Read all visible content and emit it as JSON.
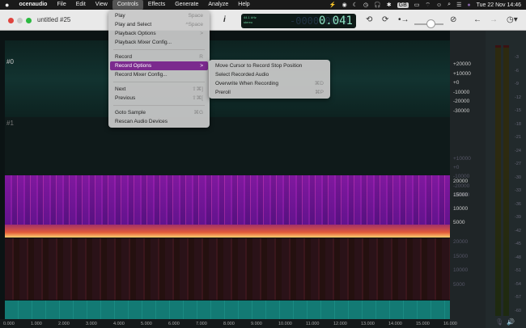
{
  "menubar": {
    "app": "ocenaudio",
    "items": [
      "File",
      "Edit",
      "View",
      "Controls",
      "Effects",
      "Generate",
      "Analyze",
      "Help"
    ],
    "clock": "Tue 22 Nov  14:46",
    "keyboard": "GB"
  },
  "window": {
    "title": "untitled #25",
    "info": "i"
  },
  "lcd": {
    "rate": "44.1 kHz",
    "channels": "stereo",
    "ghost": "-0000:00:0",
    "time": "0.041"
  },
  "tracks": [
    {
      "label": "#0"
    },
    {
      "label": "#1"
    }
  ],
  "controls_menu": [
    {
      "label": "Play",
      "shortcut": "Space"
    },
    {
      "label": "Play and Select",
      "shortcut": "^Space"
    },
    {
      "label": "Playback Options",
      "shortcut": ">"
    },
    {
      "label": "Playback Mixer Config...",
      "shortcut": ""
    },
    {
      "label": "Record",
      "shortcut": "R"
    },
    {
      "label": "Record Options",
      "shortcut": ">"
    },
    {
      "label": "Record Mixer Config...",
      "shortcut": ""
    },
    {
      "label": "Next",
      "shortcut": "⇧⌘]"
    },
    {
      "label": "Previous",
      "shortcut": "⇧⌘["
    },
    {
      "label": "Goto Sample",
      "shortcut": "⌘G"
    },
    {
      "label": "Rescan Audio Devices",
      "shortcut": ""
    }
  ],
  "record_options_menu": [
    {
      "label": "Move Cursor to Record Stop Position",
      "shortcut": ""
    },
    {
      "label": "Select Recorded Audio",
      "shortcut": ""
    },
    {
      "label": "Overwrite When Recording",
      "shortcut": "⌘D"
    },
    {
      "label": "Preroll",
      "shortcut": "⌘P"
    }
  ],
  "wave_scale": [
    "+20000",
    "+10000",
    "+0",
    "-10000",
    "-20000",
    "-30000"
  ],
  "wave_scale_dim": [
    "+10000",
    "+0",
    "-10000",
    "-20000",
    "-30000"
  ],
  "spec_scale": [
    "20000",
    "15000",
    "10000",
    "5000"
  ],
  "spec_scale_dim": [
    "20000",
    "15000",
    "10000",
    "5000"
  ],
  "meter_db": [
    "-3",
    "-6",
    "-9",
    "-12",
    "-15",
    "-18",
    "-21",
    "-24",
    "-27",
    "-30",
    "-33",
    "-36",
    "-39",
    "-42",
    "-45",
    "-48",
    "-51",
    "-54",
    "-57",
    "-60"
  ],
  "ruler": [
    "0.000",
    "1.000",
    "2.000",
    "3.000",
    "4.000",
    "5.000",
    "6.000",
    "7.000",
    "8.000",
    "9.000",
    "10.000",
    "11.000",
    "12.000",
    "13.000",
    "14.000",
    "15.000",
    "16.000"
  ],
  "colors": {
    "accent": "#7b2a8e",
    "wave0": "#2fbf95",
    "wave1": "#aaaaaa",
    "lcd": "#8fe6c6"
  }
}
